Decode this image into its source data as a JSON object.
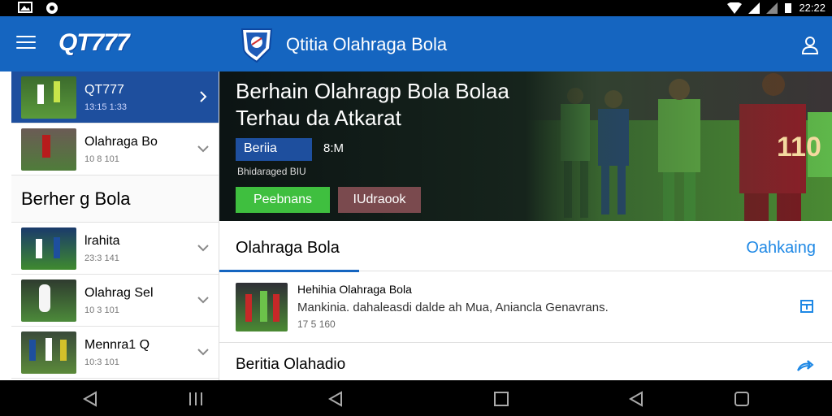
{
  "status": {
    "time": "22:22"
  },
  "appbar": {
    "logo": "QT777",
    "title": "Qtitia Olahraga Bola"
  },
  "sidebar": {
    "items": [
      {
        "title": "QT777",
        "meta": "13:15 1:33"
      },
      {
        "title": "Olahraga Bo",
        "meta": "10 8 101"
      }
    ],
    "heading": "Berher  g Bola",
    "items2": [
      {
        "title": "lrahita",
        "meta": "23:3 141"
      },
      {
        "title": "Olahrag Sel",
        "meta": "10 3 101"
      },
      {
        "title": "Mennra1 Q",
        "meta": "10:3 101"
      }
    ]
  },
  "hero": {
    "title_line1": "Berhain Olahragp Bola Bolaa",
    "title_line2": "Terhau da Atkarat",
    "tag": "Beriia",
    "tag_value": "8:M",
    "subtitle": "Bhidaraged BIU",
    "btn_primary": "Peebnans",
    "btn_secondary": "IUdraook",
    "jersey": "110"
  },
  "section": {
    "title": "Olahraga Bola",
    "link": "Oahkaing"
  },
  "news": {
    "title": "Hehihia  Olahraga Bola",
    "desc": "Mankinia. dahaleasdi dalde ah Mua, Aniancla Genavrans.",
    "meta": "17 5 160"
  },
  "news2": {
    "title": "Beritia Olahadio"
  },
  "colors": {
    "appbar": "#1565c0",
    "selected": "#1e4f9e",
    "accent_green": "#3fbf3f",
    "link": "#1e88e5"
  }
}
